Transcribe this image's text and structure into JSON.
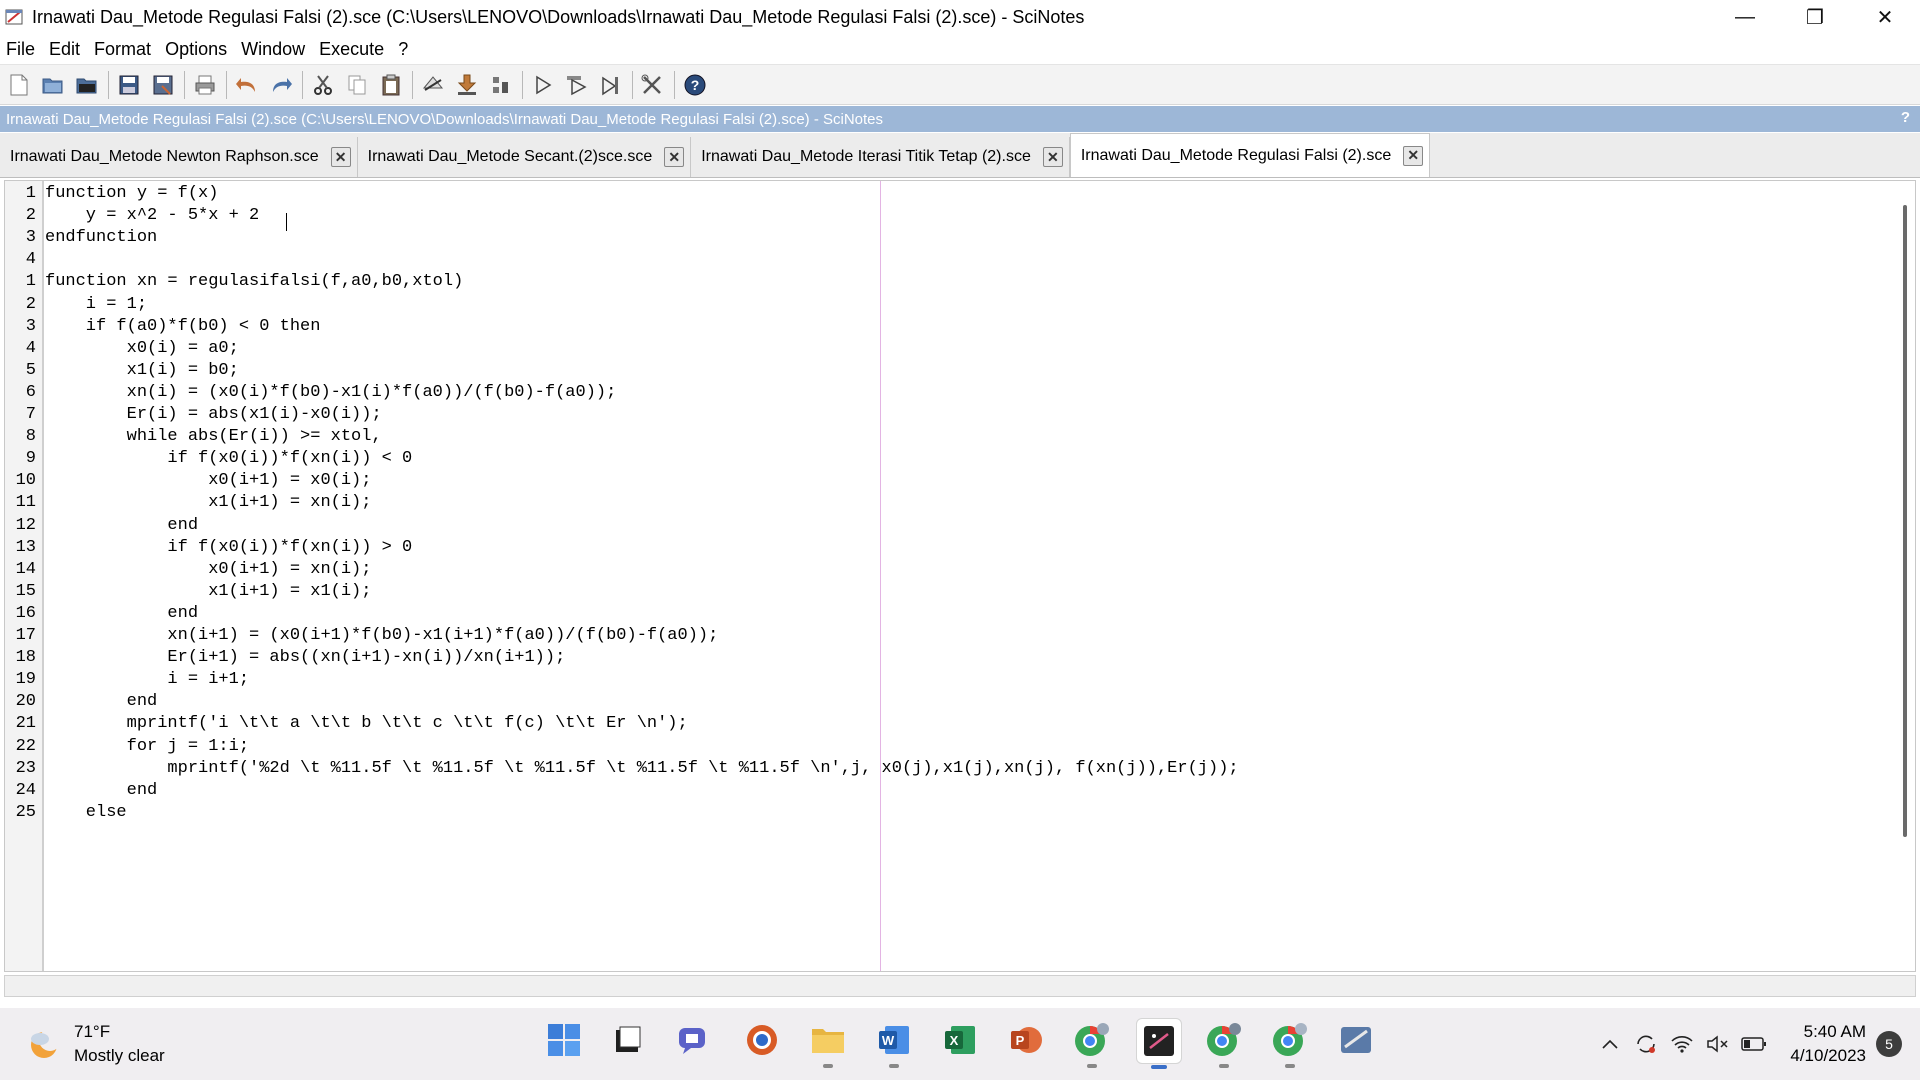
{
  "window": {
    "title": "Irnawati Dau_Metode Regulasi Falsi (2).sce (C:\\Users\\LENOVO\\Downloads\\Irnawati Dau_Metode Regulasi Falsi (2).sce) - SciNotes",
    "minimize_glyph": "—",
    "restore_glyph": "❐",
    "close_glyph": "✕"
  },
  "menu": [
    "File",
    "Edit",
    "Format",
    "Options",
    "Window",
    "Execute",
    "?"
  ],
  "infobar": {
    "text": "Irnawati Dau_Metode Regulasi Falsi (2).sce (C:\\Users\\LENOVO\\Downloads\\Irnawati Dau_Metode Regulasi Falsi (2).sce) - SciNotes",
    "help": "?"
  },
  "tabs": [
    {
      "label": "Irnawati Dau_Metode Newton Raphson.sce",
      "active": false
    },
    {
      "label": "Irnawati Dau_Metode Secant.(2)sce.sce",
      "active": false
    },
    {
      "label": "Irnawati Dau_Metode Iterasi Titik Tetap (2).sce",
      "active": false
    },
    {
      "label": "Irnawati Dau_Metode Regulasi Falsi (2).sce",
      "active": true
    }
  ],
  "tab_close_glyph": "✕",
  "line_numbers": [
    "1",
    "2",
    "3",
    "4",
    "1",
    "2",
    "3",
    "4",
    "5",
    "6",
    "7",
    "8",
    "9",
    "10",
    "11",
    "12",
    "13",
    "14",
    "15",
    "16",
    "17",
    "18",
    "19",
    "20",
    "21",
    "22",
    "23",
    "24",
    "25"
  ],
  "code_lines": [
    "function y = f(x)",
    "    y = x^2 - 5*x + 2",
    "endfunction",
    "",
    "function xn = regulasifalsi(f,a0,b0,xtol)",
    "    i = 1;",
    "    if f(a0)*f(b0) < 0 then",
    "        x0(i) = a0;",
    "        x1(i) = b0;",
    "        xn(i) = (x0(i)*f(b0)-x1(i)*f(a0))/(f(b0)-f(a0));",
    "        Er(i) = abs(x1(i)-x0(i));",
    "        while abs(Er(i)) >= xtol,",
    "            if f(x0(i))*f(xn(i)) < 0",
    "                x0(i+1) = x0(i);",
    "                x1(i+1) = xn(i);",
    "            end",
    "            if f(x0(i))*f(xn(i)) > 0",
    "                x0(i+1) = xn(i);",
    "                x1(i+1) = x1(i);",
    "            end",
    "            xn(i+1) = (x0(i+1)*f(b0)-x1(i+1)*f(a0))/(f(b0)-f(a0));",
    "            Er(i+1) = abs((xn(i+1)-xn(i))/xn(i+1));",
    "            i = i+1;",
    "        end",
    "        mprintf('i \\t\\t a \\t\\t b \\t\\t c \\t\\t f(c) \\t\\t Er \\n');",
    "        for j = 1:i;",
    "            mprintf('%2d \\t %11.5f \\t %11.5f \\t %11.5f \\t %11.5f \\t %11.5f \\n',j, x0(j),x1(j),xn(j), f(xn(j)),Er(j));",
    "        end",
    "    else"
  ],
  "weather": {
    "temp": "71°F",
    "condition": "Mostly clear"
  },
  "taskbar_apps": [
    "start-icon",
    "file-explorer-icon",
    "chat-icon",
    "browser-icon",
    "folder-icon",
    "word-icon",
    "excel-icon",
    "powerpoint-icon",
    "chrome-icon",
    "scilab-icon",
    "chrome-profile-icon",
    "chrome-profile2-icon",
    "app-icon"
  ],
  "clock": {
    "time": "5:40 AM",
    "date": "4/10/2023"
  },
  "notifications": "5",
  "tray_glyphs": {
    "chevron": "^",
    "volume": "🔇"
  },
  "colors": {
    "infobar": "#9db7d7",
    "keyword": "#2a4fa8",
    "comment": "#000000"
  }
}
